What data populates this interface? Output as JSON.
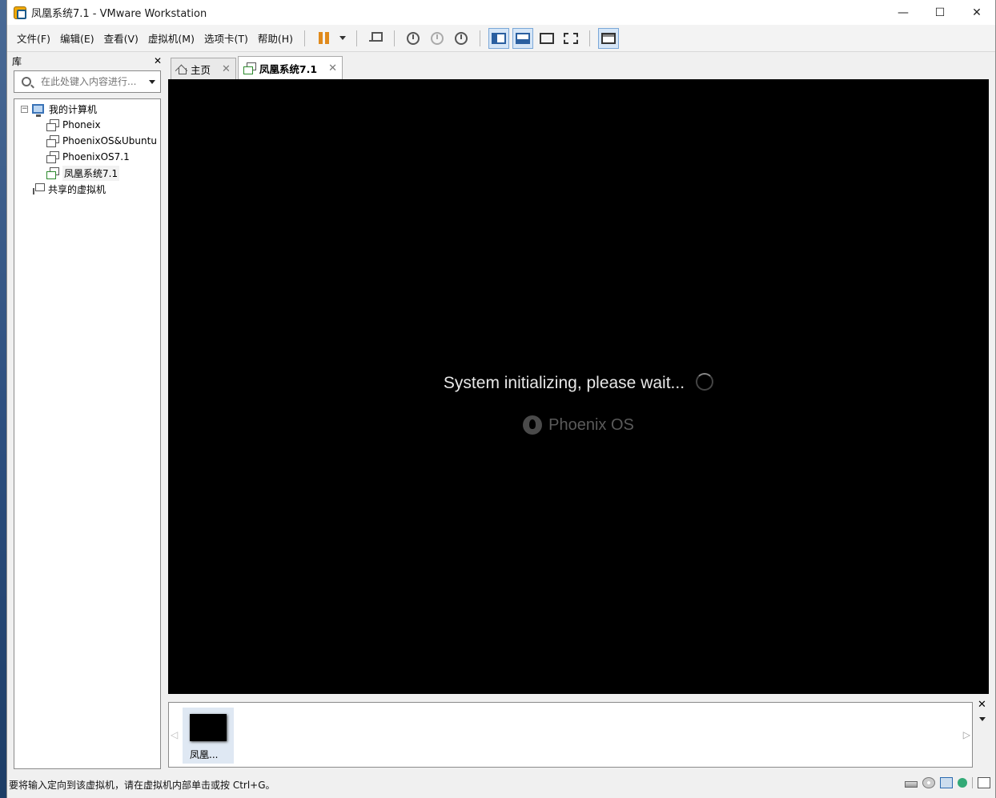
{
  "window": {
    "title": "凤凰系统7.1 - VMware Workstation",
    "controls": {
      "minimize": "—",
      "maximize": "☐",
      "close": "✕"
    }
  },
  "menu": [
    "文件(F)",
    "编辑(E)",
    "查看(V)",
    "虚拟机(M)",
    "选项卡(T)",
    "帮助(H)"
  ],
  "library": {
    "title": "库",
    "close": "✕",
    "search_placeholder": "在此处键入内容进行...",
    "tree": {
      "root": "我的计算机",
      "expander": "−",
      "vms": [
        "Phoneix",
        "PhoenixOS&Ubuntu",
        "PhoenixOS7.1",
        "凤凰系统7.1"
      ],
      "shared": "共享的虚拟机"
    }
  },
  "tabs": [
    {
      "label": "主页",
      "close": "✕"
    },
    {
      "label": "凤凰系统7.1",
      "close": "✕"
    }
  ],
  "screen": {
    "message": "System initializing, please wait...",
    "logo_text": "Phoenix OS"
  },
  "thumbnail": {
    "label": "凤凰...",
    "nav_left": "◁",
    "nav_right": "▷",
    "close": "✕"
  },
  "status": {
    "text": "要将输入定向到该虚拟机，请在虚拟机内部单击或按 Ctrl+G。"
  }
}
